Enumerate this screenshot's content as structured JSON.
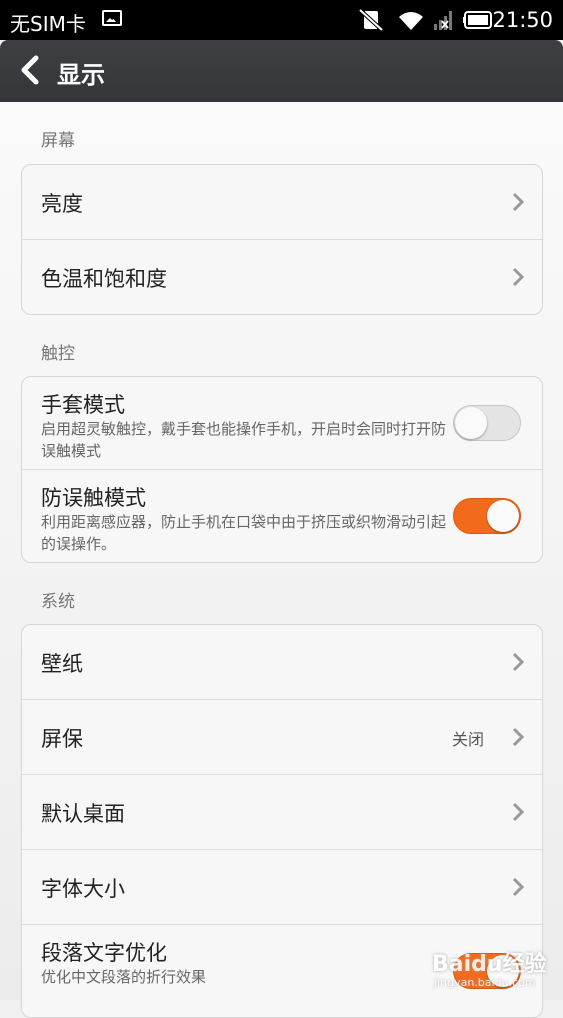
{
  "status_bar": {
    "carrier": "无SIM卡",
    "time": "21:50",
    "icons": [
      "image-icon",
      "vibrate-silent-icon",
      "wifi-icon",
      "signal-no-service-icon",
      "battery-icon"
    ]
  },
  "header": {
    "back_icon": "chevron-left-icon",
    "title": "显示"
  },
  "sections": {
    "screen": {
      "title": "屏幕",
      "items": [
        {
          "label": "亮度"
        },
        {
          "label": "色温和饱和度"
        }
      ]
    },
    "touch": {
      "title": "触控",
      "items": [
        {
          "label": "手套模式",
          "description": "启用超灵敏触控，戴手套也能操作手机，开启时会同时打开防误触模式",
          "enabled": false
        },
        {
          "label": "防误触模式",
          "description": "利用距离感应器，防止手机在口袋中由于挤压或织物滑动引起的误操作。",
          "enabled": true
        }
      ]
    },
    "system": {
      "title": "系统",
      "items": [
        {
          "label": "壁纸"
        },
        {
          "label": "屏保",
          "value": "关闭"
        },
        {
          "label": "默认桌面"
        },
        {
          "label": "字体大小"
        },
        {
          "label": "段落文字优化",
          "description": "优化中文段落的折行效果",
          "enabled": true
        }
      ]
    }
  },
  "watermark": {
    "text": "Baidu经验",
    "url": "jingyan.baidu.com"
  },
  "colors": {
    "accent": "#f36a1c",
    "header_bg": "#3a3c40",
    "status_bar_bg": "#000000"
  }
}
